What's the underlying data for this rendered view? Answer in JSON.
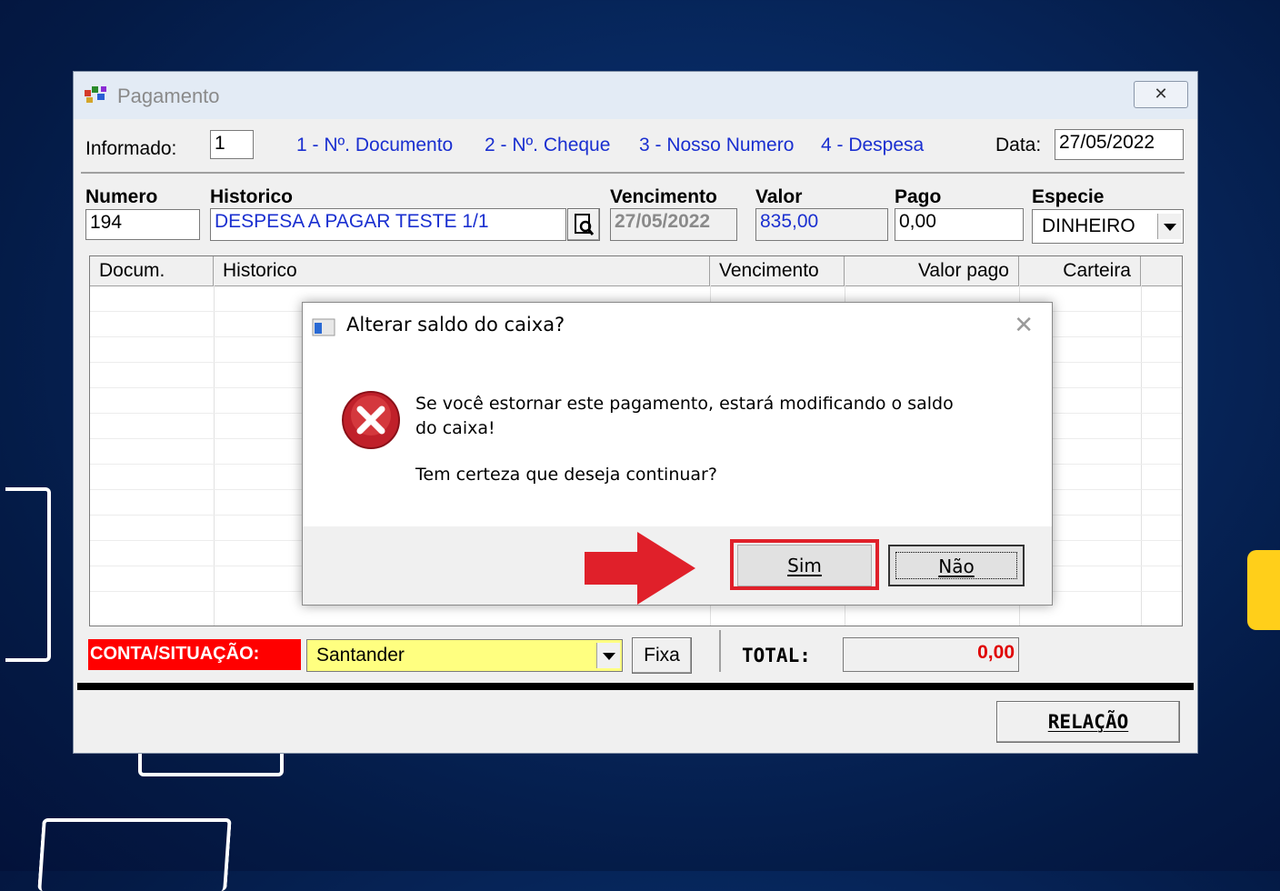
{
  "main_window": {
    "title": "Pagamento",
    "informado_label": "Informado:",
    "informado_value": "1",
    "options": [
      "1 - Nº. Documento",
      "2 - Nº. Cheque",
      "3 - Nosso Numero",
      "4 - Despesa"
    ],
    "data_label": "Data:",
    "data_value": "27/05/2022",
    "fields": {
      "numero_label": "Numero",
      "numero_value": "194",
      "historico_label": "Historico",
      "historico_value": "DESPESA A PAGAR TESTE 1/1",
      "vencimento_label": "Vencimento",
      "vencimento_value": "27/05/2022",
      "valor_label": "Valor",
      "valor_value": "835,00",
      "pago_label": "Pago",
      "pago_value": "0,00",
      "especie_label": "Especie",
      "especie_value": "DINHEIRO"
    },
    "grid_columns": [
      "Docum.",
      "Historico",
      "Vencimento",
      "Valor pago",
      "Carteira"
    ],
    "conta_label": "CONTA/SITUAÇÃO:",
    "conta_value": "Santander",
    "fixa_label": "Fixa",
    "total_label": "TOTAL:",
    "total_value": "0,00",
    "relacao_label": "RELAÇÃO"
  },
  "dialog": {
    "title": "Alterar saldo do caixa?",
    "message_line1": "Se você estornar este pagamento, estará modificando o saldo",
    "message_line2": "do caixa!",
    "question": "Tem certeza que deseja continuar?",
    "yes_label": "Sim",
    "no_label": "Não",
    "icon": "error-icon"
  },
  "colors": {
    "option_link": "#1a2fd0",
    "conta_label_bg": "#ff0000",
    "conta_field_bg": "#ffff80",
    "total_value": "#e00000",
    "highlight_box": "#e0202a",
    "arrow": "#e0202a"
  }
}
